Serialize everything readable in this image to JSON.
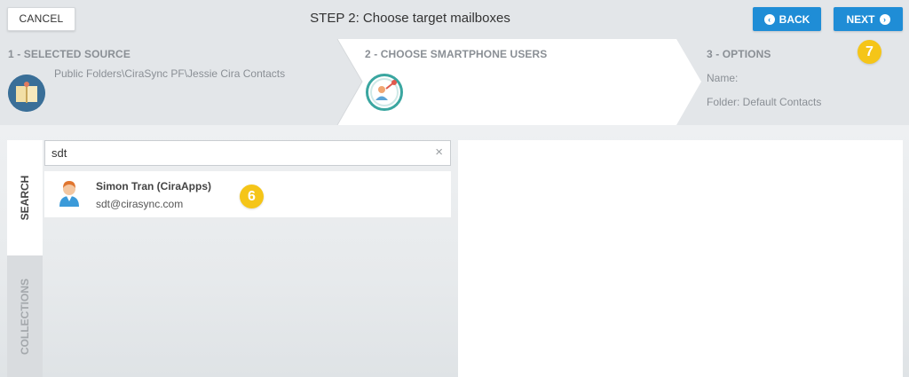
{
  "header": {
    "title": "STEP 2: Choose target mailboxes",
    "cancel_label": "CANCEL",
    "back_label": "BACK",
    "next_label": "NEXT"
  },
  "steps": {
    "source": {
      "title": "1 - SELECTED SOURCE",
      "path": "Public Folders\\CiraSync PF\\Jessie Cira Contacts"
    },
    "users": {
      "title": "2 - CHOOSE SMARTPHONE USERS"
    },
    "options": {
      "title": "3 - OPTIONS",
      "name_label": "Name:",
      "folder_label": "Folder: Default Contacts"
    }
  },
  "badges": {
    "next_badge": "7",
    "result_badge": "6"
  },
  "tabs": {
    "search": "SEARCH",
    "collections": "COLLECTIONS"
  },
  "search": {
    "value": "sdt",
    "clear": "×"
  },
  "results": [
    {
      "name": "Simon Tran (CiraApps)",
      "email": "sdt@cirasync.com"
    }
  ],
  "colors": {
    "primary": "#1f8dd6",
    "badge": "#f5c518",
    "accent_teal": "#3aa6a0"
  }
}
